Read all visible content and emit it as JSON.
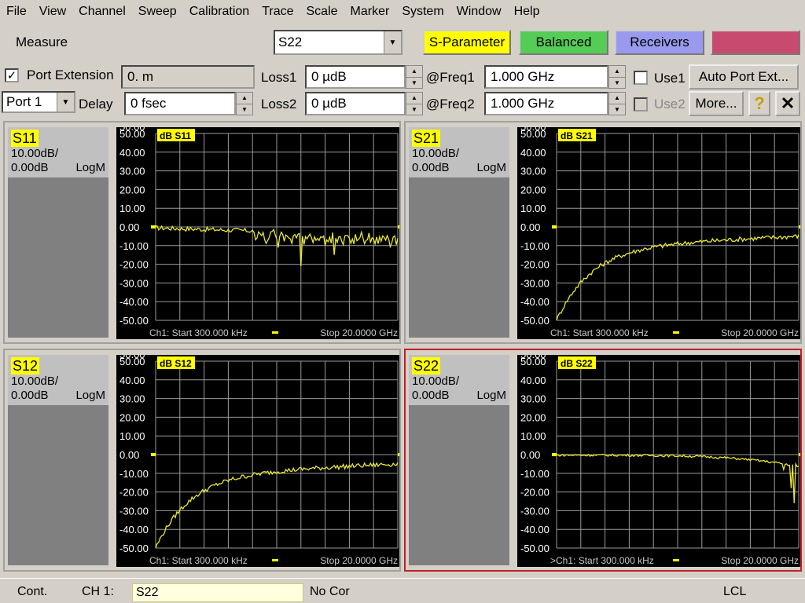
{
  "menu": [
    "File",
    "View",
    "Channel",
    "Sweep",
    "Calibration",
    "Trace",
    "Scale",
    "Marker",
    "System",
    "Window",
    "Help"
  ],
  "measure": {
    "label": "Measure",
    "selected": "S22",
    "buttons": {
      "s_parameter": "S-Parameter",
      "balanced": "Balanced",
      "receivers": "Receivers"
    },
    "colors": {
      "s_parameter": "#ffff00",
      "balanced": "#55cc55",
      "receivers": "#9999ee",
      "extra": "#c84a6e"
    }
  },
  "port_ext": {
    "checkbox_label": "Port Extension",
    "checked_mark": "✓",
    "distance": "0. m",
    "port": "Port 1",
    "delay_label": "Delay",
    "delay": "0 fsec",
    "loss1_label": "Loss1",
    "loss1": "0 µdB",
    "loss2_label": "Loss2",
    "loss2": "0 µdB",
    "freq1_label": "@Freq1",
    "freq1": "1.000 GHz",
    "freq2_label": "@Freq2",
    "freq2": "1.000 GHz",
    "use1_label": "Use1",
    "use2_label": "Use2",
    "auto_btn": "Auto Port Ext...",
    "more_btn": "More...",
    "help_btn": "?",
    "close_btn": "✕"
  },
  "panes": [
    {
      "id": "S11",
      "tag": "S11",
      "scale": "10.00dB/",
      "ref": "0.00dB",
      "fmt": "LogM",
      "title": "dB S11",
      "start": "Ch1: Start  300.000 kHz",
      "stop": "Stop  20.0000 GHz",
      "active": false,
      "shape": "flat"
    },
    {
      "id": "S21",
      "tag": "S21",
      "scale": "10.00dB/",
      "ref": "0.00dB",
      "fmt": "LogM",
      "title": "dB S21",
      "start": "Ch1: Start  300.000 kHz",
      "stop": "Stop  20.0000 GHz",
      "active": false,
      "shape": "rise"
    },
    {
      "id": "S12",
      "tag": "S12",
      "scale": "10.00dB/",
      "ref": "0.00dB",
      "fmt": "LogM",
      "title": "dB S12",
      "start": "Ch1: Start  300.000 kHz",
      "stop": "Stop  20.0000 GHz",
      "active": false,
      "shape": "rise"
    },
    {
      "id": "S22",
      "tag": "S22",
      "scale": "10.00dB/",
      "ref": "0.00dB",
      "fmt": "LogM",
      "title": "dB S22",
      "start": ">Ch1: Start  300.000 kHz",
      "stop": "Stop  20.0000 GHz",
      "active": true,
      "shape": "flat2"
    }
  ],
  "y_ticks": [
    "50.00",
    "40.00",
    "30.00",
    "20.00",
    "10.00",
    "0.00",
    "-10.00",
    "-20.00",
    "-30.00",
    "-40.00",
    "-50.00"
  ],
  "status": {
    "mode": "Cont.",
    "channel": "CH 1:",
    "trace": "S22",
    "cor": "No Cor",
    "lcl": "LCL"
  }
}
